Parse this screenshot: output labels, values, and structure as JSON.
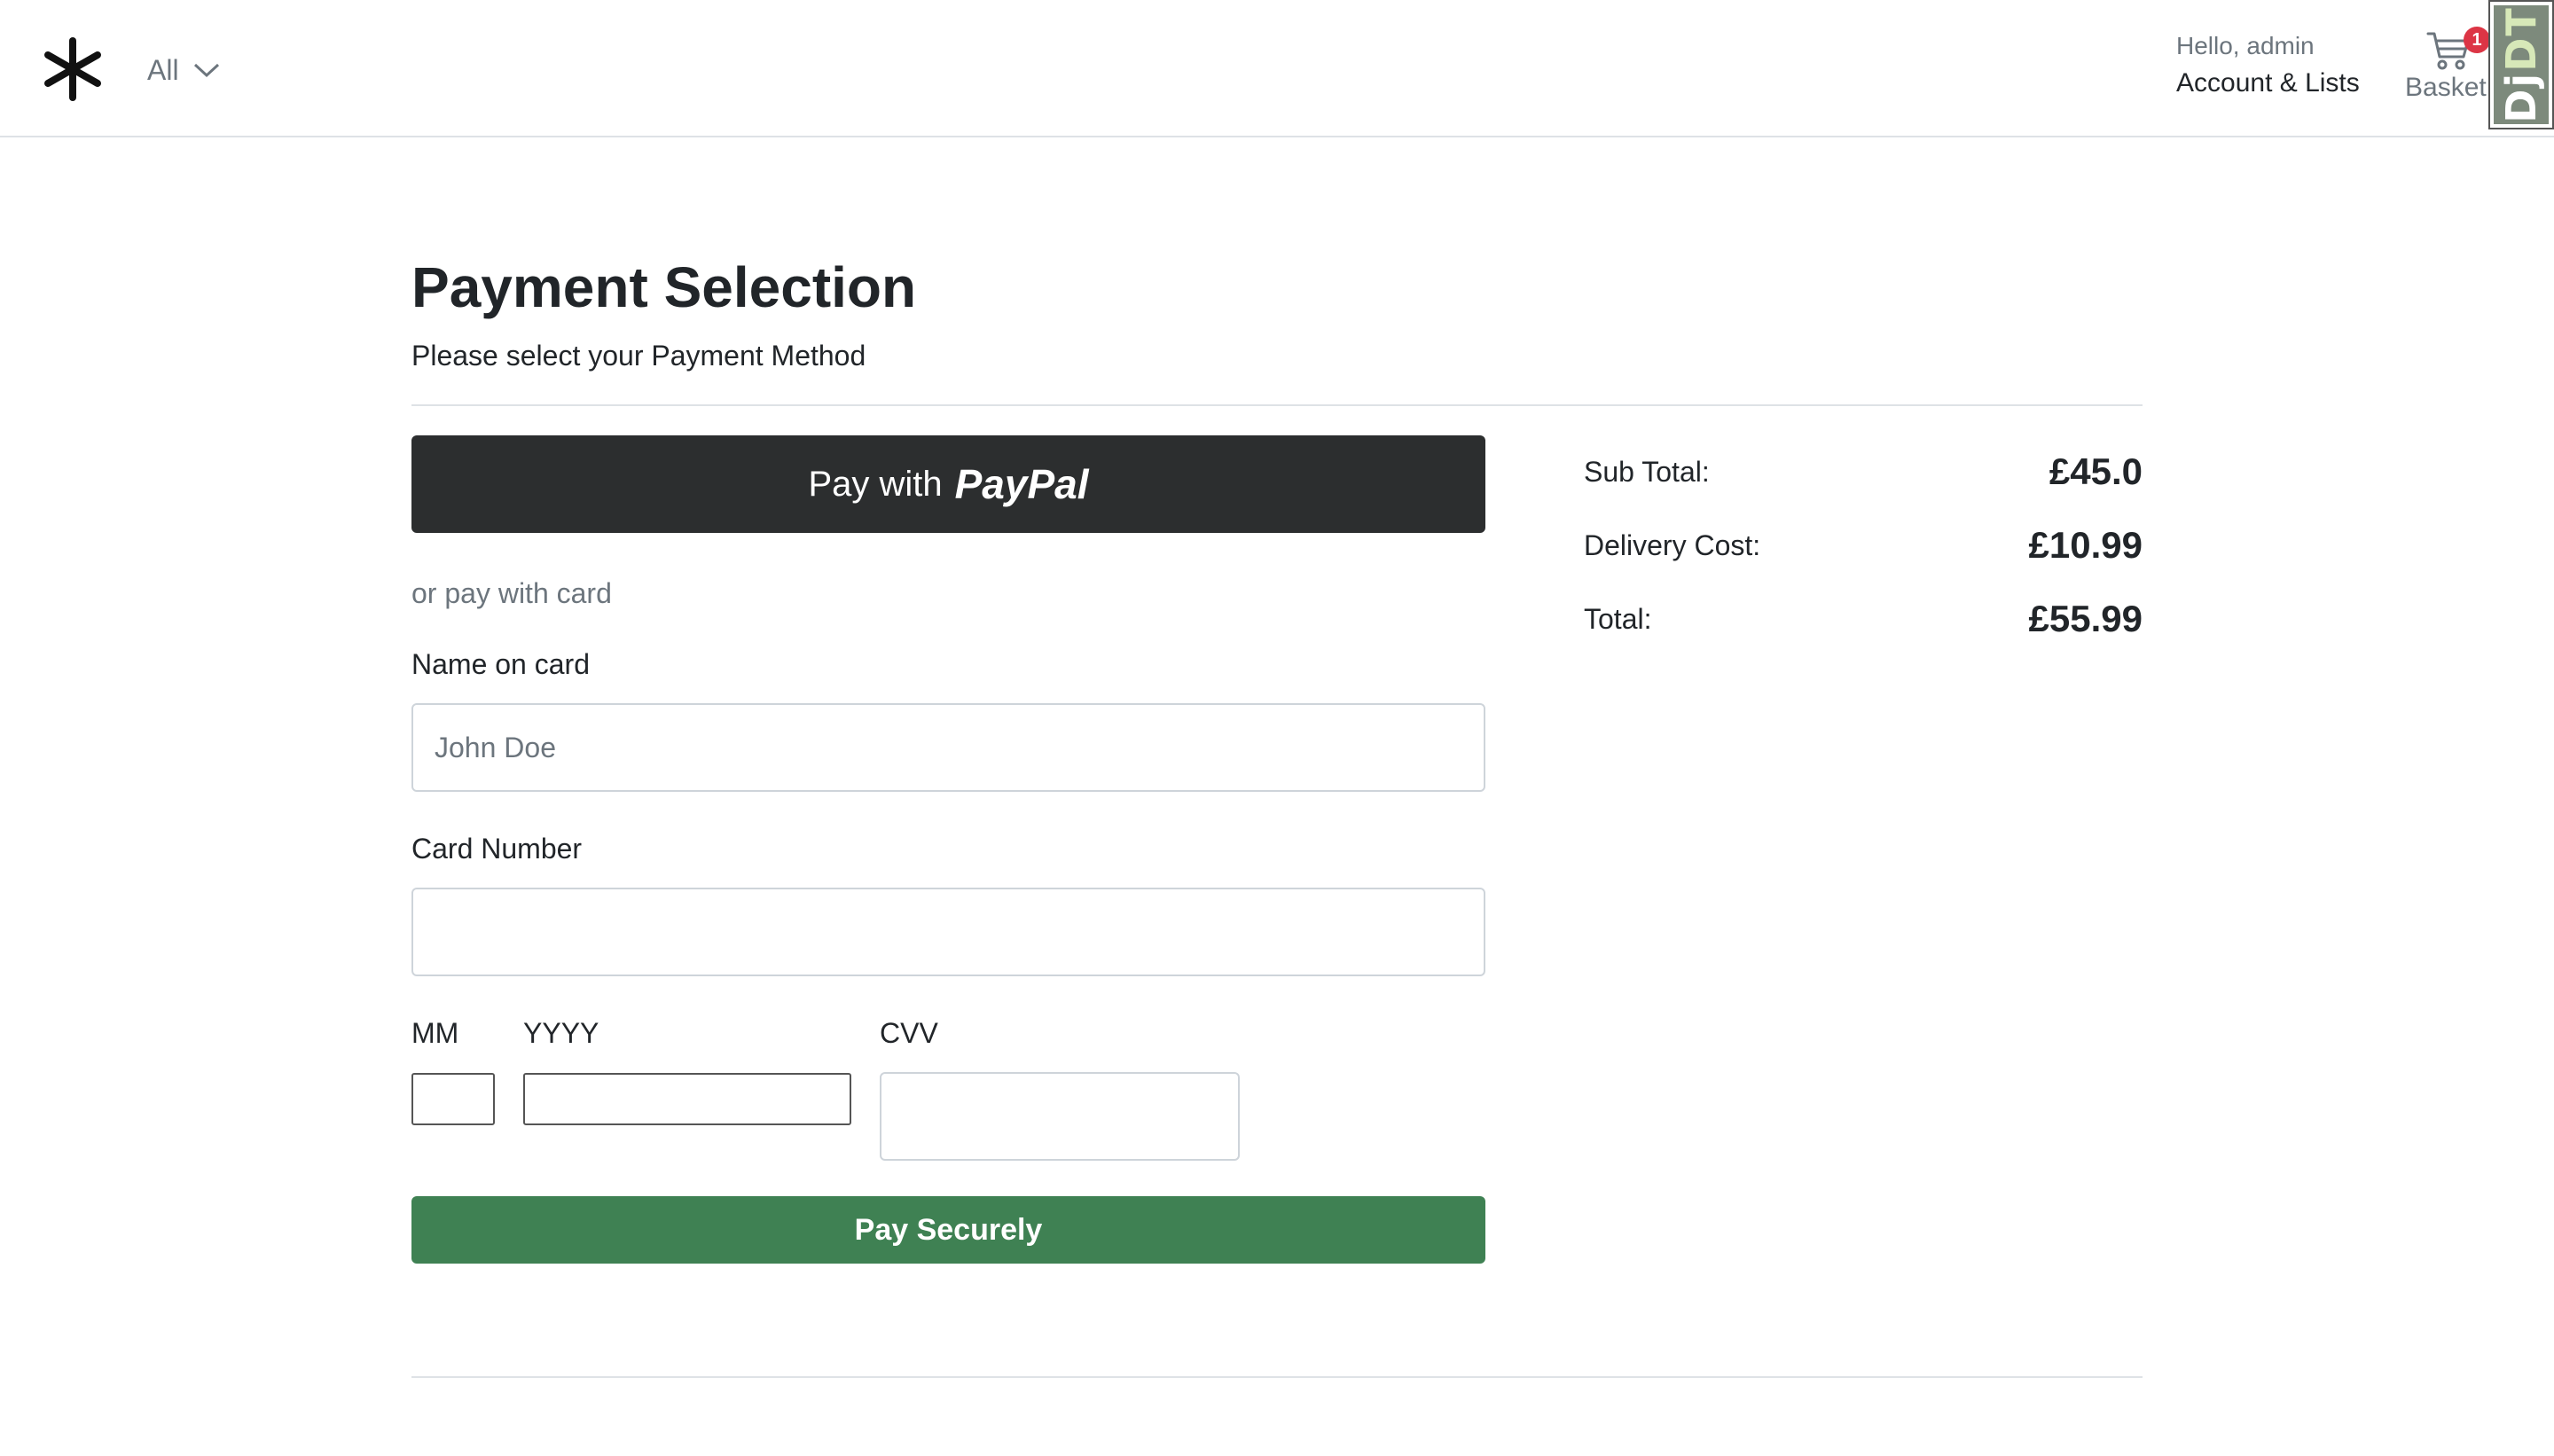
{
  "header": {
    "logo_icon": "asterisk-logo-icon",
    "category_select": {
      "selected": "All",
      "icon": "chevron-down-icon"
    },
    "account": {
      "greeting": "Hello, admin",
      "link": "Account & Lists"
    },
    "basket": {
      "count": "1",
      "label": "Basket",
      "icon": "cart-icon"
    },
    "debug_toolbar": {
      "label_dj": "Dj",
      "label_dt": "DT"
    }
  },
  "main": {
    "title": "Payment Selection",
    "subtitle": "Please select your Payment Method",
    "paypal_button": {
      "prefix": "Pay with",
      "brand": "PayPal"
    },
    "or_pay_with_card": "or pay with card",
    "form": {
      "name_label": "Name on card",
      "name_placeholder": "John Doe",
      "name_value": "",
      "card_number_label": "Card Number",
      "card_number_value": "",
      "month_label": "MM",
      "year_label": "YYYY",
      "cvv_label": "CVV",
      "submit_label": "Pay Securely"
    }
  },
  "summary": {
    "sub_total_label": "Sub Total:",
    "sub_total_value": "£45.0",
    "delivery_label": "Delivery Cost:",
    "delivery_value": "£10.99",
    "total_label": "Total:",
    "total_value": "£55.99"
  },
  "colors": {
    "paypal_button": "#2c2e2f",
    "pay_button": "#3f8153",
    "badge": "#dc3545"
  }
}
